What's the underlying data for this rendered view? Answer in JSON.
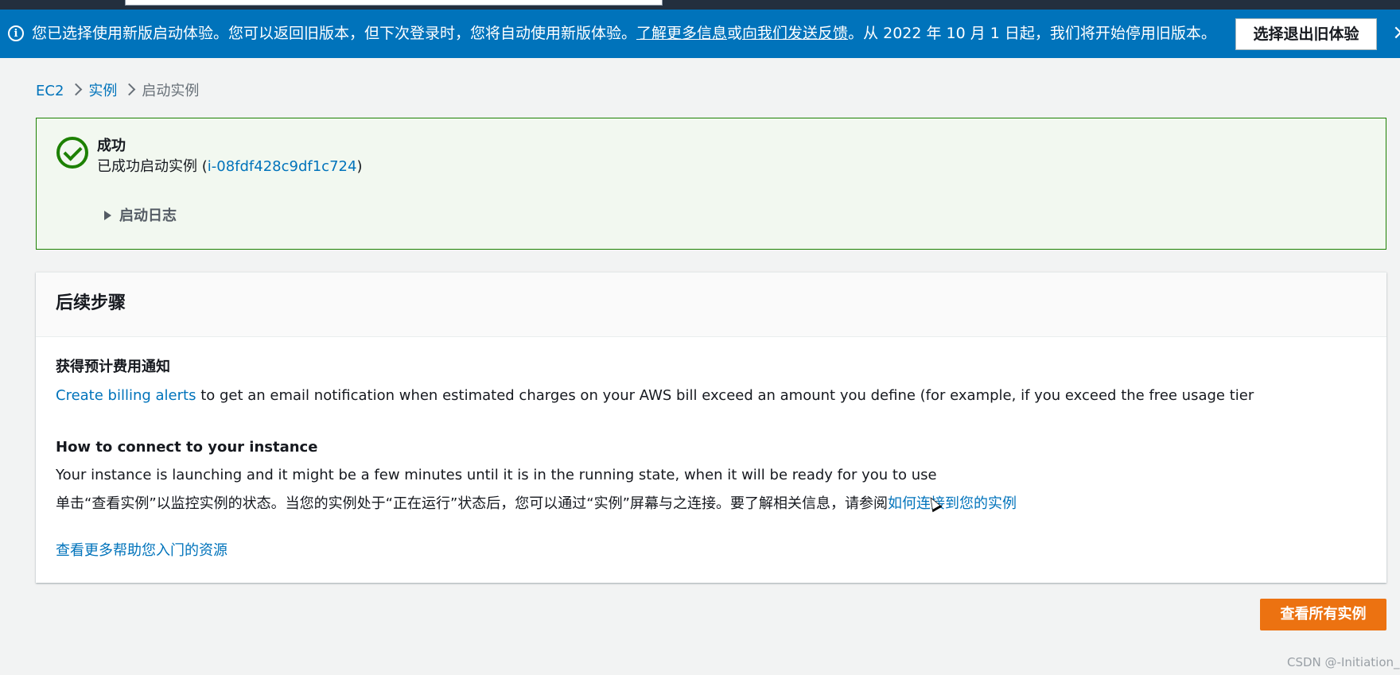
{
  "banner": {
    "text_before": "您已选择使用新版启动体验。您可以返回旧版本，但下次登录时，您将自动使用新版体验。",
    "link_learn": "了解更多信息",
    "text_or": "或",
    "link_feedback": "向我们发送反馈",
    "text_after": "。从 2022 年 10 月 1 日起，我们将开始停用旧版本。",
    "opt_out_label": "选择退出旧体验",
    "close_symbol": "×"
  },
  "breadcrumb": {
    "items": [
      "EC2",
      "实例",
      "启动实例"
    ]
  },
  "success": {
    "title": "成功",
    "message_before": "已成功启动实例 (",
    "instance_id": "i-08fdf428c9df1c724",
    "message_after": ")",
    "log_label": "启动日志"
  },
  "next_steps": {
    "title": "后续步骤",
    "billing_title": "获得预计费用通知",
    "billing_link": "Create billing alerts",
    "billing_text": " to get an email notification when estimated charges on your AWS bill exceed an amount you define (for example, if you exceed the free usage tier",
    "connect_title": "How to connect to your instance",
    "connect_text": "Your instance is launching and it might be a few minutes until it is in the running state, when it will be ready for you to use",
    "connect_cn_text": "单击“查看实例”以监控实例的状态。当您的实例处于“正在运行”状态后，您可以通过“实例”屏幕与之连接。要了解相关信息，请参阅",
    "connect_cn_link": "如何连接到您的实例",
    "resources_link": "查看更多帮助您入门的资源"
  },
  "view_all_label": "查看所有实例",
  "watermark": "CSDN @-Initiation_",
  "colors": {
    "banner": "#0073bb",
    "success_border": "#1d8102",
    "link": "#0073bb",
    "primary": "#ec7211"
  }
}
